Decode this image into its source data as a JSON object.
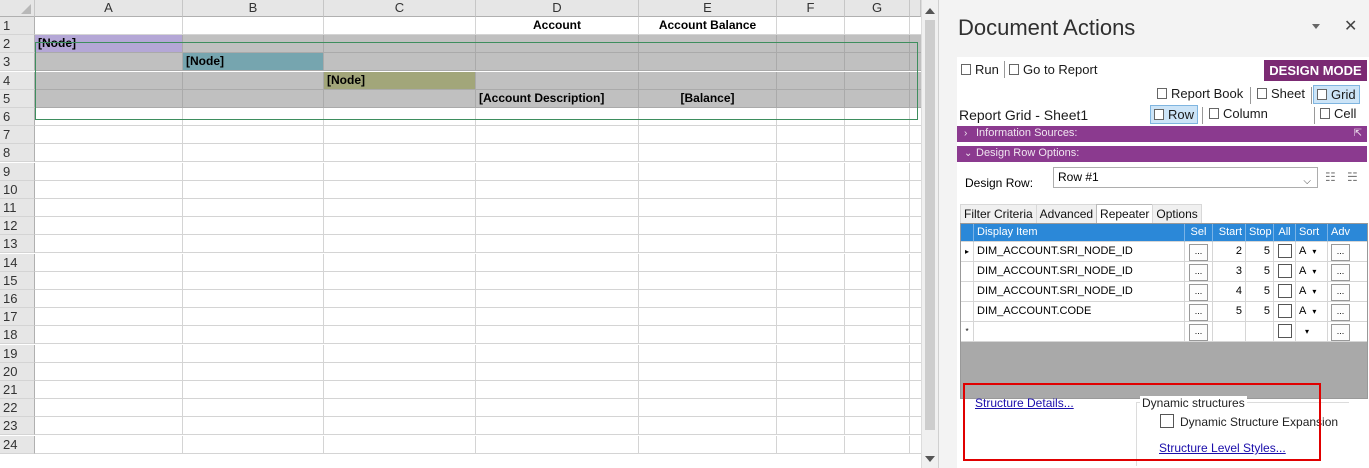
{
  "sheet": {
    "columns": [
      "A",
      "B",
      "C",
      "D",
      "E",
      "F",
      "G"
    ],
    "rows": [
      {
        "n": "1",
        "cells": {
          "D": "Account",
          "E": "Account Balance"
        }
      },
      {
        "n": "2",
        "cells": {
          "A": "[Node]"
        }
      },
      {
        "n": "3",
        "cells": {
          "B": "[Node]"
        }
      },
      {
        "n": "4",
        "cells": {
          "C": "[Node]"
        }
      },
      {
        "n": "5",
        "cells": {
          "D": "[Account Description]",
          "E": "[Balance]"
        }
      },
      {
        "n": "6"
      },
      {
        "n": "7"
      },
      {
        "n": "8"
      },
      {
        "n": "9"
      },
      {
        "n": "10"
      },
      {
        "n": "11"
      },
      {
        "n": "12"
      },
      {
        "n": "13"
      },
      {
        "n": "14"
      },
      {
        "n": "15"
      },
      {
        "n": "16"
      },
      {
        "n": "17"
      },
      {
        "n": "18"
      },
      {
        "n": "19"
      },
      {
        "n": "20"
      },
      {
        "n": "21"
      },
      {
        "n": "22"
      },
      {
        "n": "23"
      },
      {
        "n": "24"
      }
    ],
    "colors": {
      "node_level_1": "#b4a7d6",
      "node_level_2": "#76a5af",
      "node_level_3": "#a2a67a",
      "design_region": "#c0c0c0"
    }
  },
  "panel": {
    "title": "Document Actions",
    "dropdown_icon": "chevron-down-icon",
    "close_icon": "close-icon",
    "toolbar": {
      "run_label": "Run",
      "goto_label": "Go to Report",
      "mode_badge": "DESIGN MODE",
      "mode_color": "#7b2a73"
    },
    "scope_buttons": {
      "report_book": "Report Book",
      "sheet": "Sheet",
      "grid": "Grid"
    },
    "grid_title": "Report Grid - Sheet1",
    "axis_buttons": {
      "row": "Row",
      "column": "Column",
      "cell": "Cell"
    },
    "sections": {
      "info_sources": "Information Sources:",
      "design_row_options": "Design Row Options:"
    },
    "design_row": {
      "label": "Design Row:",
      "value": "Row #1"
    },
    "tabs": [
      "Filter Criteria",
      "Advanced",
      "Repeater",
      "Options"
    ],
    "active_tab": "Repeater",
    "repeater_grid": {
      "headers": [
        "Display Item",
        "Sel",
        "Start",
        "Stop",
        "All",
        "Sort",
        "Adv"
      ],
      "rows": [
        {
          "item": "DIM_ACCOUNT.SRI_NODE_ID",
          "sel": "...",
          "start": "2",
          "stop": "5",
          "sort": "A",
          "adv": "..."
        },
        {
          "item": "DIM_ACCOUNT.SRI_NODE_ID",
          "sel": "...",
          "start": "3",
          "stop": "5",
          "sort": "A",
          "adv": "..."
        },
        {
          "item": "DIM_ACCOUNT.SRI_NODE_ID",
          "sel": "...",
          "start": "4",
          "stop": "5",
          "sort": "A",
          "adv": "..."
        },
        {
          "item": "DIM_ACCOUNT.CODE",
          "sel": "...",
          "start": "5",
          "stop": "5",
          "sort": "A",
          "adv": "..."
        },
        {
          "item": "",
          "sel": "...",
          "start": "",
          "stop": "",
          "sort": "",
          "adv": "..."
        }
      ],
      "header_color": "#2b88d8"
    },
    "structure_details_link": "Structure Details...",
    "dynamic": {
      "legend": "Dynamic structures",
      "expansion_label": "Dynamic Structure Expansion",
      "expansion_checked": false,
      "level_styles_link": "Structure Level Styles..."
    },
    "highlight_color": "#e00000"
  }
}
